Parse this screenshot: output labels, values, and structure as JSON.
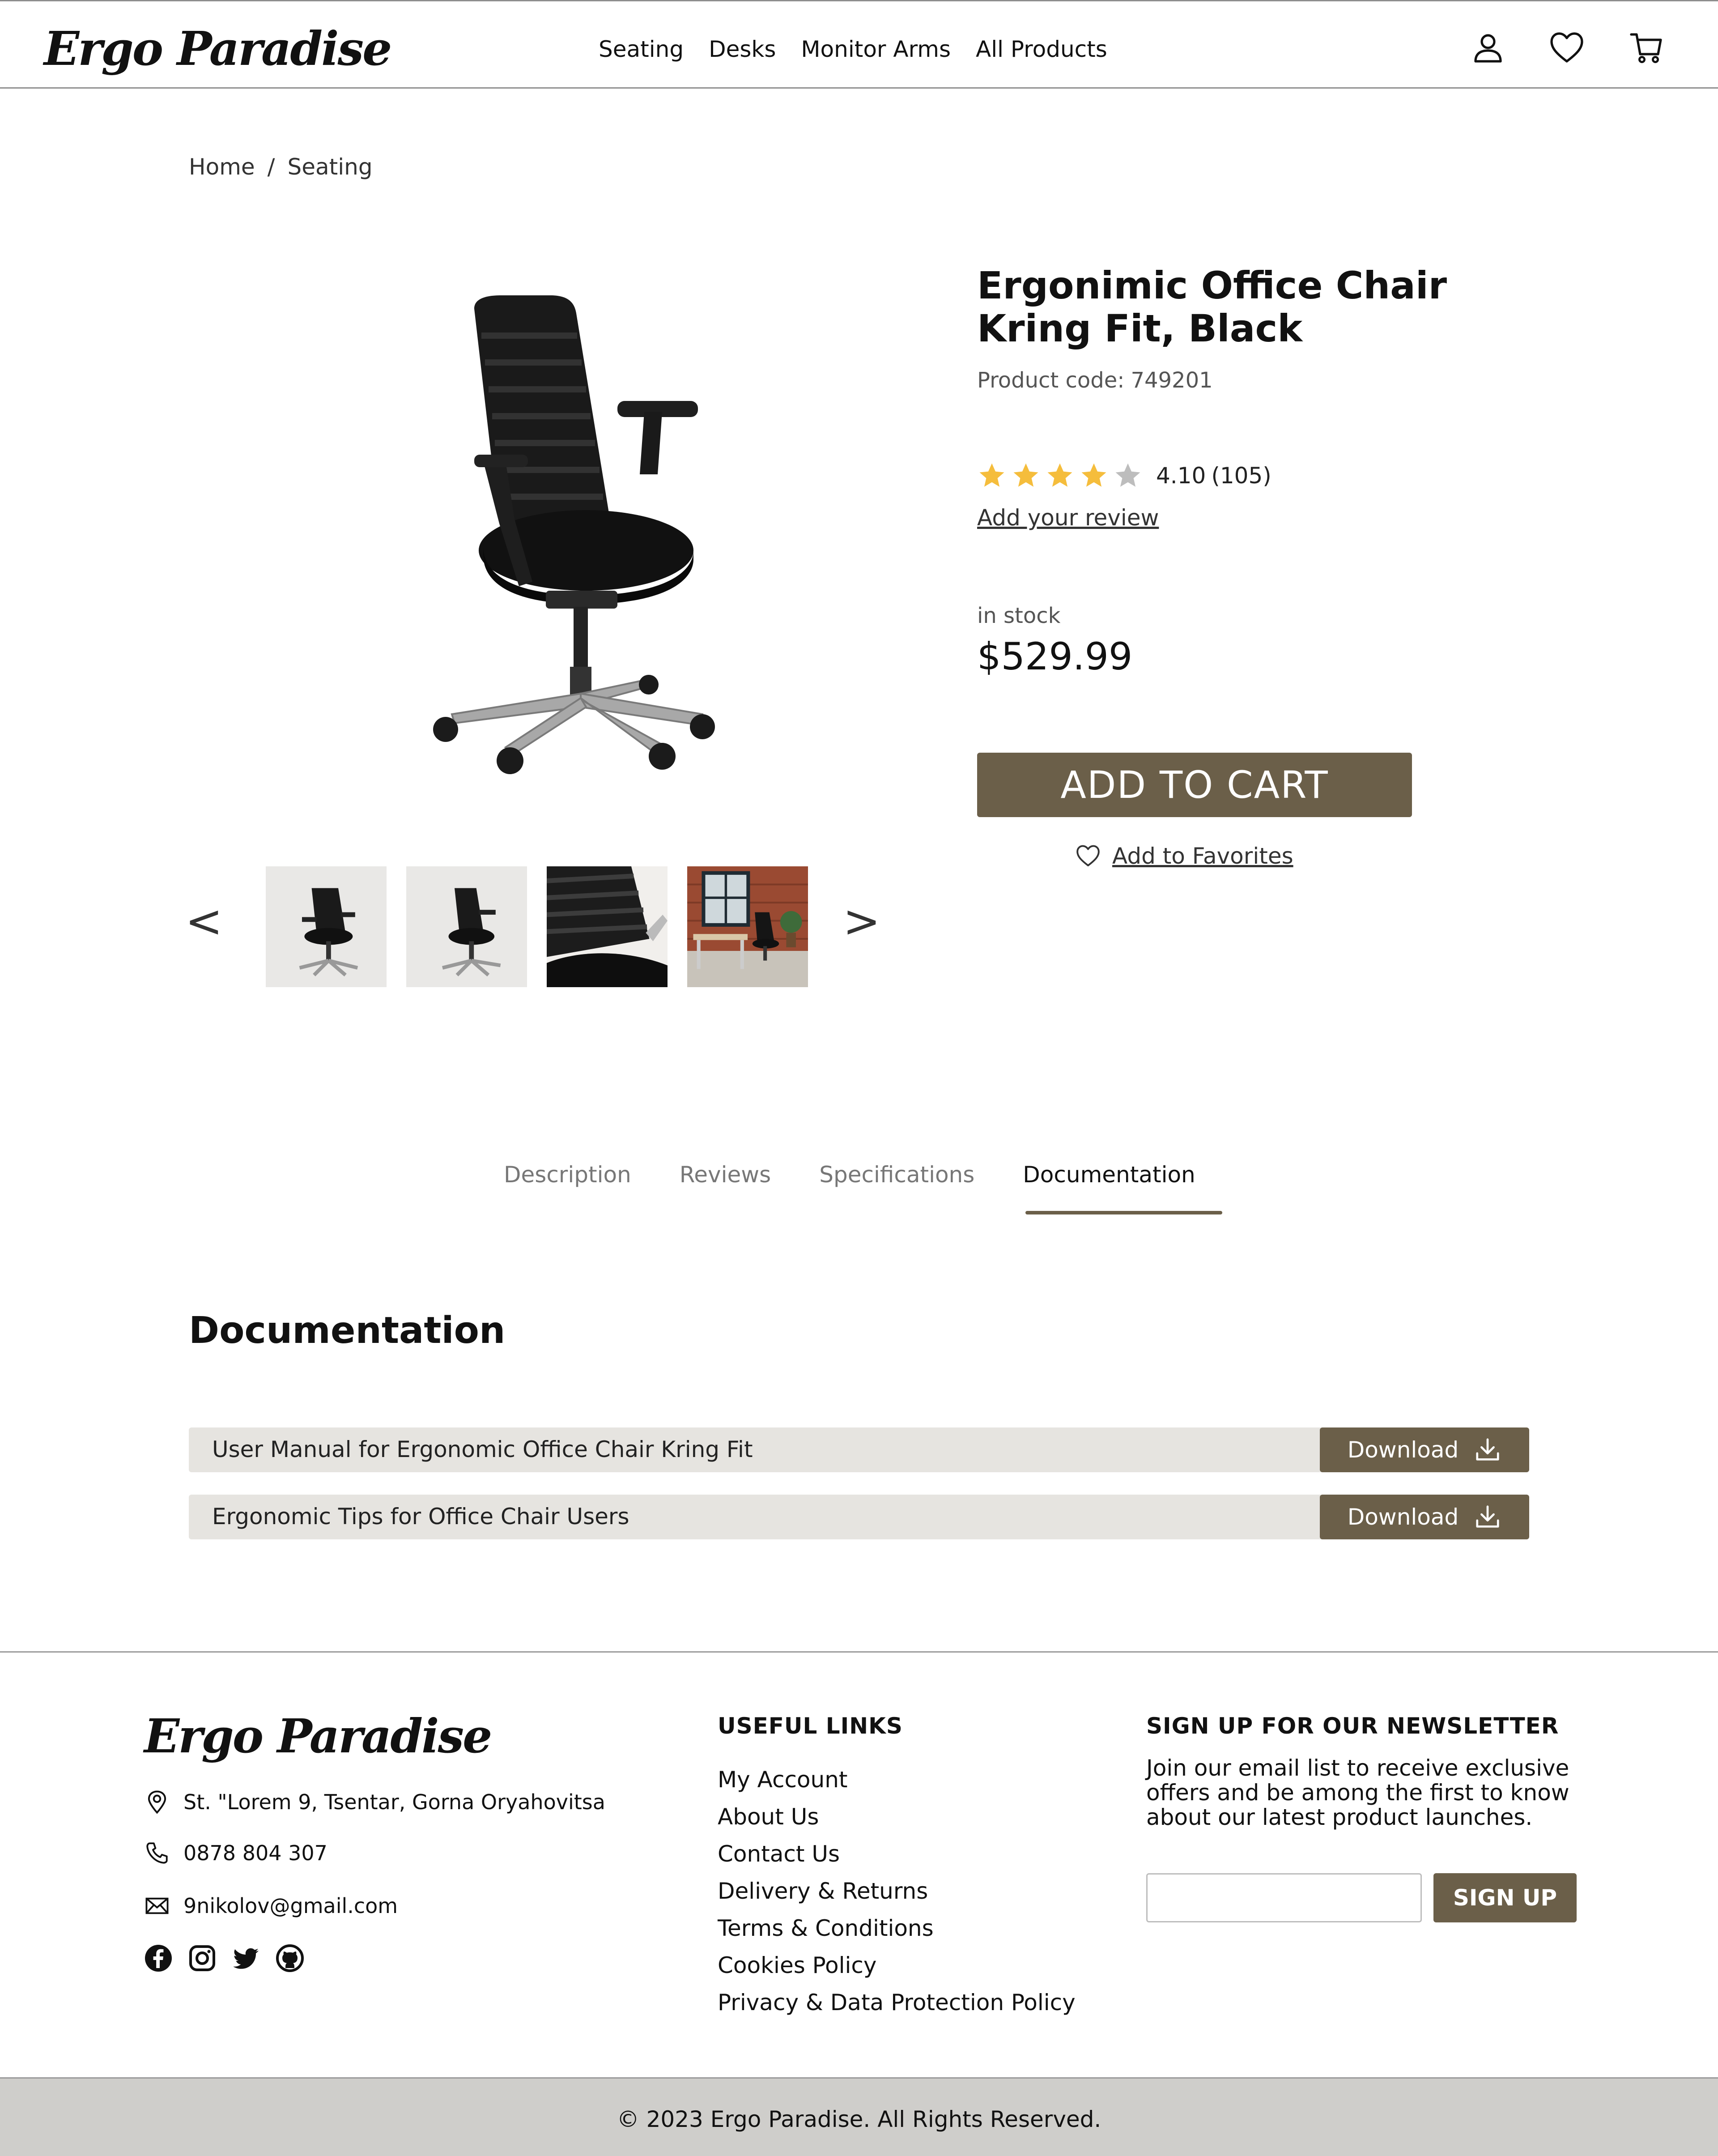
{
  "brand": {
    "name": "Ergo Paradise"
  },
  "nav": {
    "items": [
      {
        "label": "Seating"
      },
      {
        "label": "Desks"
      },
      {
        "label": "Monitor Arms"
      },
      {
        "label": "All Products"
      }
    ]
  },
  "header_icons": [
    "user-icon",
    "heart-icon",
    "cart-icon"
  ],
  "breadcrumb": {
    "items": [
      "Home",
      "Seating"
    ],
    "separator": "/"
  },
  "product": {
    "title": "Ergonimic Office Chair Kring Fit, Black",
    "code_label": "Product code:",
    "code": "749201",
    "rating": "4.10",
    "rating_value": 4.1,
    "stars_filled": 4,
    "stars_total": 5,
    "review_count": "(105)",
    "add_review": "Add your review",
    "stock": "in stock",
    "price": "$529.99",
    "add_to_cart": "ADD TO CART",
    "add_to_favorites": "Add to Favorites"
  },
  "gallery": {
    "prev": "<",
    "next": ">",
    "thumbnails": [
      "chair-front",
      "chair-angle",
      "chair-mesh-closeup",
      "chair-in-office"
    ]
  },
  "tabs": {
    "items": [
      {
        "label": "Description"
      },
      {
        "label": "Reviews"
      },
      {
        "label": "Specifications"
      },
      {
        "label": "Documentation"
      }
    ],
    "active": "Documentation"
  },
  "documentation": {
    "heading": "Documentation",
    "files": [
      {
        "title": "User Manual for Ergonomic Office Chair Kring Fit",
        "button": "Download"
      },
      {
        "title": "Ergonomic Tips for Office Chair Users",
        "button": "Download"
      }
    ]
  },
  "footer": {
    "address": "St. \"Lorem 9, Tsentar, Gorna Oryahovitsa",
    "phone": "0878 804 307",
    "email": "9nikolov@gmail.com",
    "socials": [
      "facebook-icon",
      "instagram-icon",
      "twitter-icon",
      "github-icon"
    ],
    "links_heading": "USEFUL LINKS",
    "links": [
      "My Account",
      "About Us",
      "Contact Us",
      "Delivery & Returns",
      "Terms & Conditions",
      "Cookies Policy",
      "Privacy & Data Protection Policy"
    ],
    "newsletter_heading": "SIGN UP FOR OUR NEWSLETTER",
    "newsletter_text": "Join our email list to receive exclusive offers and be among the first to know about our latest product launches.",
    "newsletter_button": "SIGN UP",
    "newsletter_input_value": "",
    "copyright": "© 2023 Ergo Paradise. All Rights Reserved."
  },
  "colors": {
    "accent": "#6b5f49",
    "star": "#f5bd3c",
    "star_empty": "#bdbdbd",
    "doc_row_bg": "#e6e4e0",
    "copyright_bg": "#cfcecb"
  }
}
